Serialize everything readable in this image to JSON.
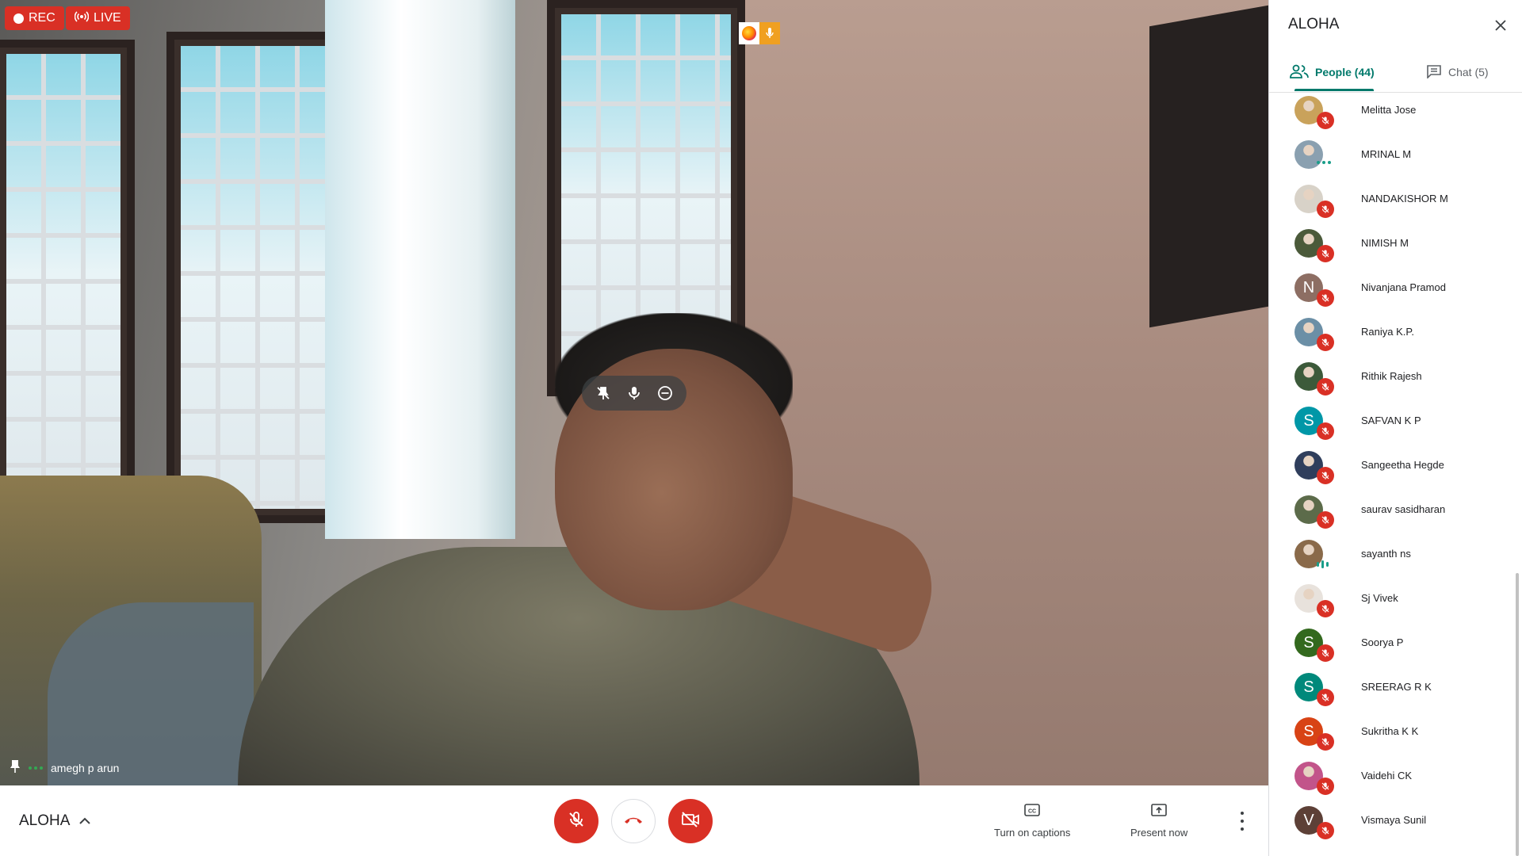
{
  "top_indicators": {
    "rec_label": "REC",
    "live_label": "LIVE"
  },
  "video": {
    "participant_name": "amegh p arun"
  },
  "bottom_bar": {
    "meeting_name": "ALOHA",
    "captions_label": "Turn on captions",
    "present_label": "Present now"
  },
  "side_panel": {
    "title": "ALOHA",
    "tabs": {
      "people": "People (44)",
      "chat": "Chat (5)"
    },
    "participants": [
      {
        "name": "Melitta Jose",
        "avatar": "photo",
        "color": "#c9a25b",
        "status": "muted"
      },
      {
        "name": "MRINAL M",
        "avatar": "photo",
        "color": "#8aa0b0",
        "status": "speaking-dots"
      },
      {
        "name": "NANDAKISHOR M",
        "avatar": "photo",
        "color": "#d8d2c8",
        "status": "muted"
      },
      {
        "name": "NIMISH M",
        "avatar": "photo",
        "color": "#4b5a3a",
        "status": "muted"
      },
      {
        "name": "Nivanjana Pramod",
        "avatar": "N",
        "color": "#8d6e63",
        "status": "muted"
      },
      {
        "name": "Raniya K.P.",
        "avatar": "photo",
        "color": "#6b8fa6",
        "status": "muted"
      },
      {
        "name": "Rithik Rajesh",
        "avatar": "photo",
        "color": "#3c5a3a",
        "status": "muted"
      },
      {
        "name": "SAFVAN K P",
        "avatar": "S",
        "color": "#0097a7",
        "status": "muted"
      },
      {
        "name": "Sangeetha Hegde",
        "avatar": "photo",
        "color": "#2f3e5c",
        "status": "muted"
      },
      {
        "name": "saurav sasidharan",
        "avatar": "photo",
        "color": "#5c6b4a",
        "status": "muted"
      },
      {
        "name": "sayanth ns",
        "avatar": "photo",
        "color": "#8a6a4a",
        "status": "speaking-bars"
      },
      {
        "name": "Sj Vivek",
        "avatar": "photo",
        "color": "#e8e2dc",
        "status": "muted"
      },
      {
        "name": "Soorya P",
        "avatar": "S",
        "color": "#33691e",
        "status": "muted"
      },
      {
        "name": "SREERAG R K",
        "avatar": "S",
        "color": "#00897b",
        "status": "muted"
      },
      {
        "name": "Sukritha K K",
        "avatar": "S",
        "color": "#d84315",
        "status": "muted"
      },
      {
        "name": "Vaidehi CK",
        "avatar": "photo",
        "color": "#c2548a",
        "status": "muted"
      },
      {
        "name": "Vismaya Sunil",
        "avatar": "V",
        "color": "#5d4037",
        "status": "muted"
      }
    ]
  }
}
